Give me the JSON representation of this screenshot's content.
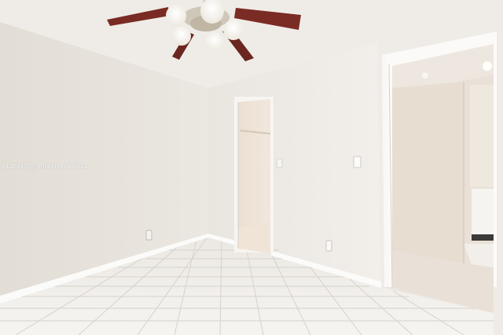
{
  "photo": {
    "watermark": "A1459453@ Miami MLS 2024"
  },
  "colors": {
    "ceiling": "#efece7",
    "left_wall": "#e6e1da",
    "back_wall": "#eeebe6",
    "right_wall": "#efece8",
    "floor_tile": "#f3f1ed",
    "grout": "#d9d5cf",
    "baseboard": "#fbfbfa",
    "fan_blade": "#7a2b24",
    "fan_light": "#fbf9f2"
  },
  "objects": [
    "ceiling-fan-with-lights",
    "closet-doorway",
    "bathroom-doorway",
    "light-switch",
    "electrical-outlet",
    "tile-floor"
  ]
}
